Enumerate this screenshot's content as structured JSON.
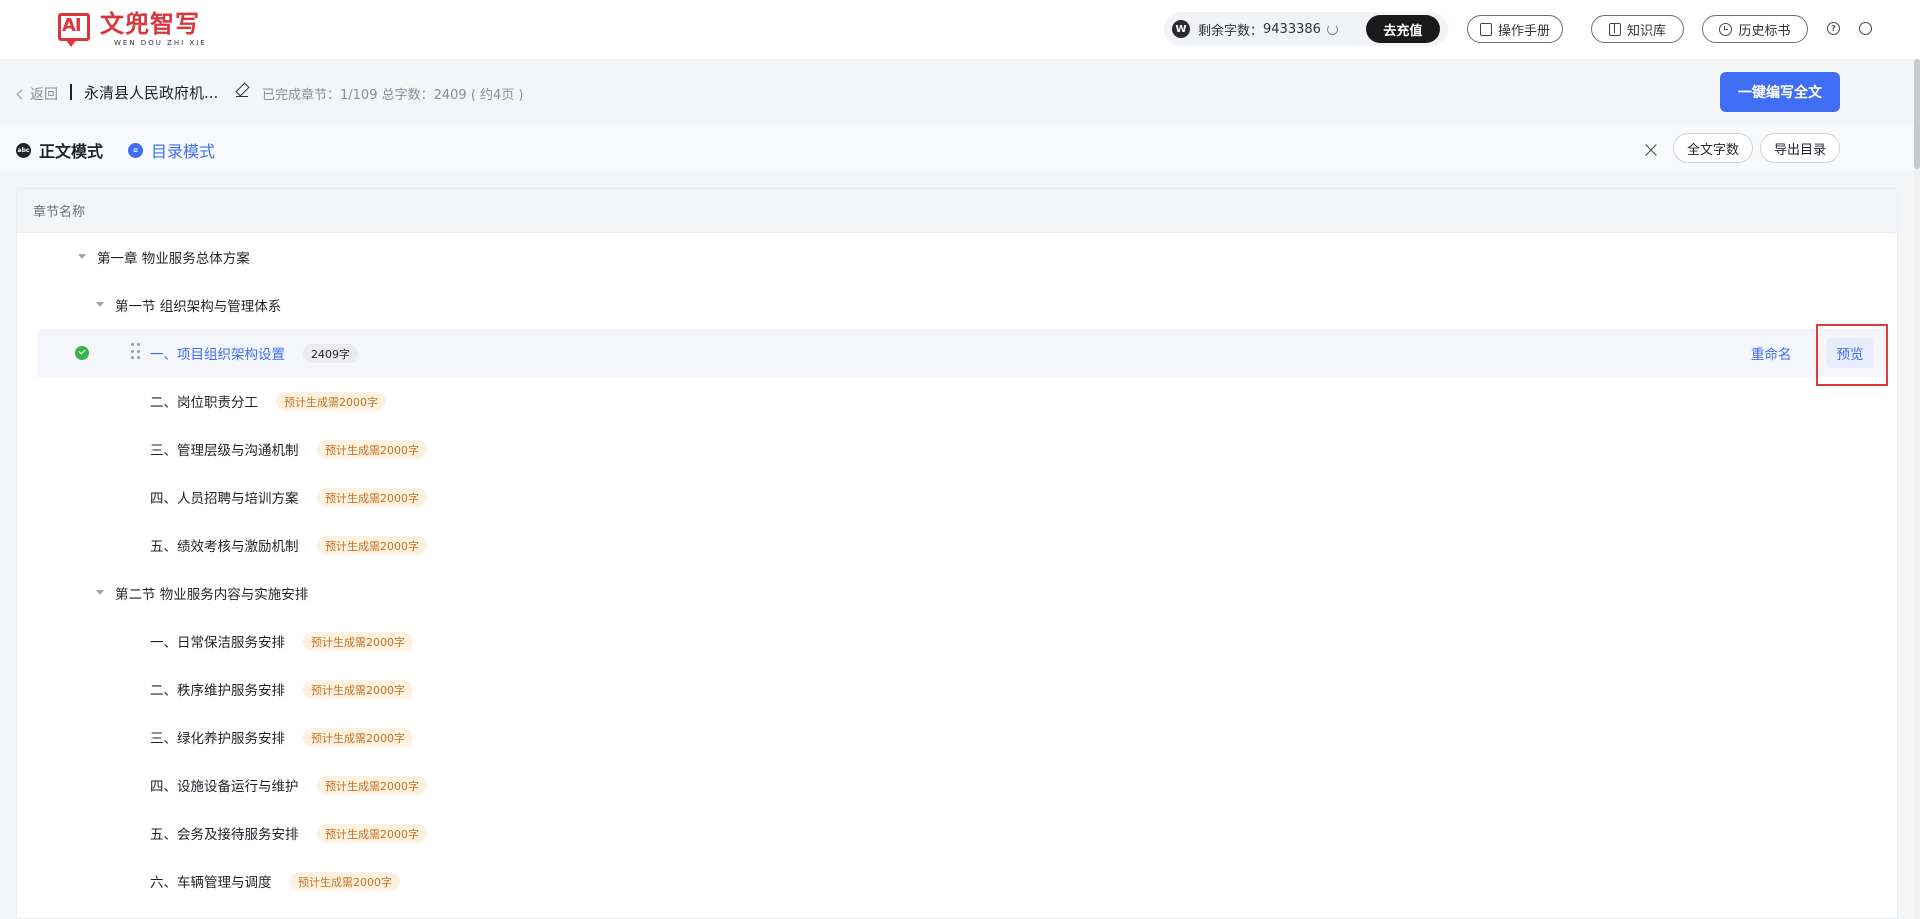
{
  "logo": {
    "cn": "文兜智写",
    "en": "WEN DOU ZHI XIE",
    "mark": "AI"
  },
  "header": {
    "balance_label": "剩余字数：",
    "balance_value": "9433386",
    "recharge": "去充值",
    "manual": "操作手册",
    "knowledge": "知识库",
    "history": "历史标书"
  },
  "doc": {
    "back": "返回",
    "title": "永清县人民政府机...",
    "progress": "已完成章节：1/109 总字数：2409 ( 约4页 )",
    "write_all": "一键编写全文"
  },
  "modes": {
    "text_mode": "正文模式",
    "outline_mode": "目录模式",
    "word_count": "全文字数",
    "export": "导出目录"
  },
  "table": {
    "header": "章节名称",
    "rows": [
      {
        "level": 1,
        "label": "第一章 物业服务总体方案"
      },
      {
        "level": 2,
        "label": "第一节 组织架构与管理体系"
      },
      {
        "level": 3,
        "label": "一、项目组织架构设置",
        "tag": "2409字",
        "done": true
      },
      {
        "level": 3,
        "label": "二、岗位职责分工",
        "tag": "预计生成需2000字"
      },
      {
        "level": 3,
        "label": "三、管理层级与沟通机制",
        "tag": "预计生成需2000字"
      },
      {
        "level": 3,
        "label": "四、人员招聘与培训方案",
        "tag": "预计生成需2000字"
      },
      {
        "level": 3,
        "label": "五、绩效考核与激励机制",
        "tag": "预计生成需2000字"
      },
      {
        "level": 2,
        "label": "第二节 物业服务内容与实施安排"
      },
      {
        "level": 3,
        "label": "一、日常保洁服务安排",
        "tag": "预计生成需2000字"
      },
      {
        "level": 3,
        "label": "二、秩序维护服务安排",
        "tag": "预计生成需2000字"
      },
      {
        "level": 3,
        "label": "三、绿化养护服务安排",
        "tag": "预计生成需2000字"
      },
      {
        "level": 3,
        "label": "四、设施设备运行与维护",
        "tag": "预计生成需2000字"
      },
      {
        "level": 3,
        "label": "五、会务及接待服务安排",
        "tag": "预计生成需2000字"
      },
      {
        "level": 3,
        "label": "六、车辆管理与调度",
        "tag": "预计生成需2000字"
      }
    ],
    "rename": "重命名",
    "preview": "预览"
  },
  "colors": {
    "accent": "#3f6ef5",
    "brand": "#d9363e",
    "highlight": "#e23b3b"
  }
}
